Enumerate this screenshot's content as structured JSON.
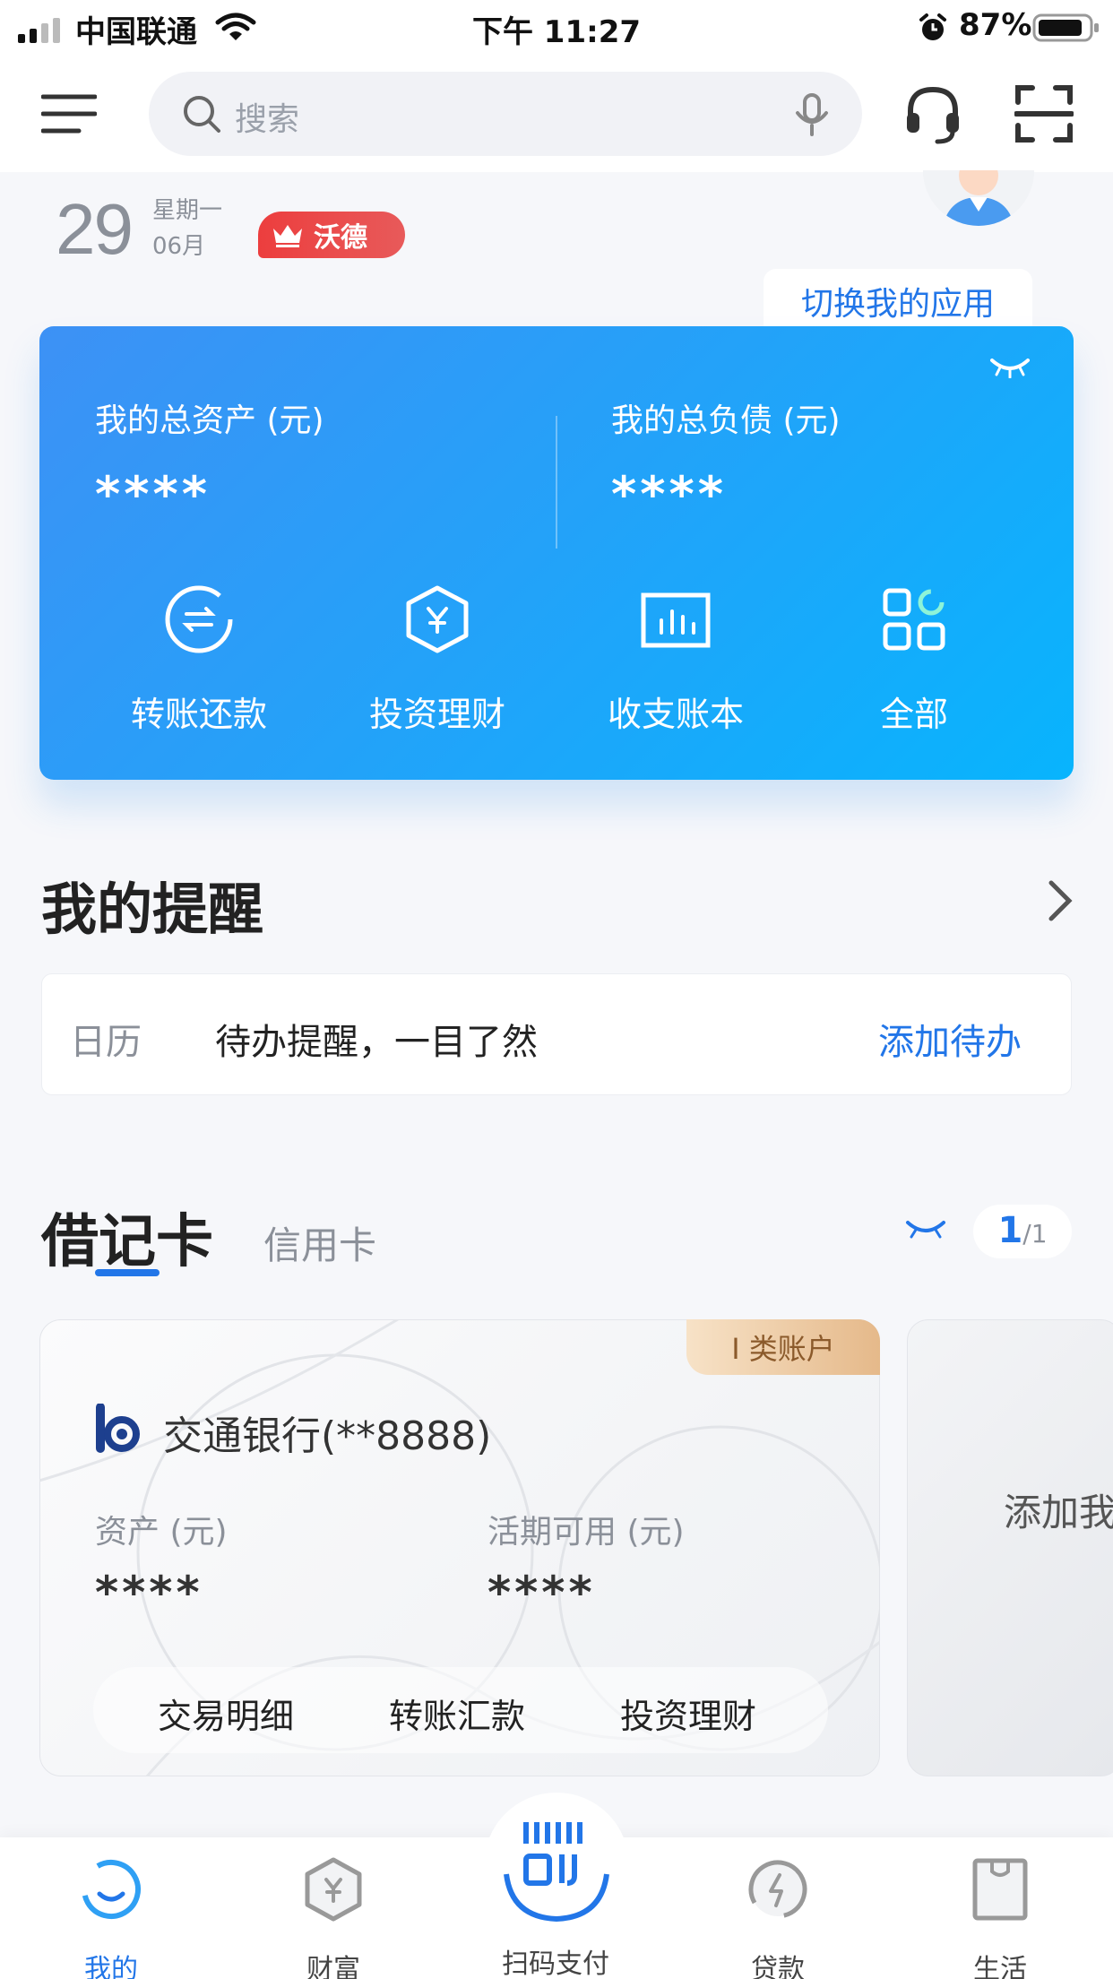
{
  "status_bar": {
    "carrier": "中国联通",
    "time": "下午 11:27",
    "battery": "87%"
  },
  "header": {
    "search_placeholder": "搜索"
  },
  "date": {
    "day": "29",
    "weekday": "星期一",
    "month": "06月",
    "vip_label": "沃德"
  },
  "switch_app_label": "切换我的应用",
  "assets_card": {
    "total_assets_label": "我的总资产 (元)",
    "total_assets_value": "****",
    "total_debt_label": "我的总负债 (元)",
    "total_debt_value": "****",
    "actions": [
      {
        "label": "转账还款",
        "icon": "transfer-icon"
      },
      {
        "label": "投资理财",
        "icon": "invest-icon"
      },
      {
        "label": "收支账本",
        "icon": "ledger-icon"
      },
      {
        "label": "全部",
        "icon": "all-apps-icon"
      }
    ]
  },
  "reminders": {
    "title": "我的提醒",
    "calendar_label": "日历",
    "text": "待办提醒，一目了然",
    "add_label": "添加待办"
  },
  "cards": {
    "tab_debit": "借记卡",
    "tab_credit": "信用卡",
    "page_current": "1",
    "page_total": "/1",
    "debit_card": {
      "badge": "I 类账户",
      "bank_name": "交通银行(**8888)",
      "assets_label": "资产 (元)",
      "assets_value": "****",
      "available_label": "活期可用 (元)",
      "available_value": "****",
      "actions": [
        "交易明细",
        "转账汇款",
        "投资理财"
      ]
    },
    "add_card_text": "添加我"
  },
  "bottom_nav": {
    "items": [
      {
        "label": "我的",
        "icon": "my-icon",
        "active": true
      },
      {
        "label": "财富",
        "icon": "wealth-icon"
      },
      {
        "label": "扫码支付",
        "icon": "scan-pay-icon"
      },
      {
        "label": "贷款",
        "icon": "loan-icon"
      },
      {
        "label": "生活",
        "icon": "life-icon"
      }
    ]
  },
  "colors": {
    "accent": "#2276e8",
    "card_gradient_start": "#3d91f5",
    "card_gradient_end": "#08b4fd",
    "vip_red": "#ec3e3e"
  }
}
